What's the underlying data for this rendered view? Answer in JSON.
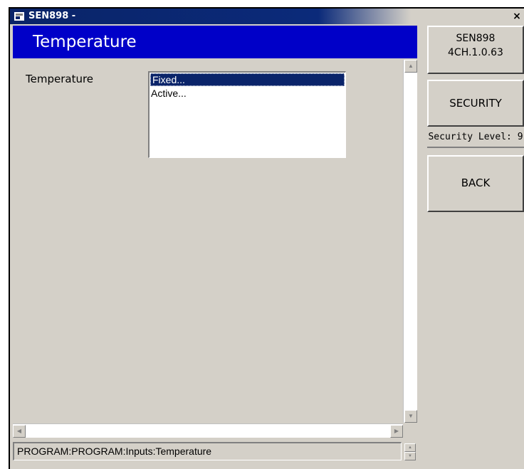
{
  "window": {
    "title": "SEN898 -",
    "close_glyph": "×"
  },
  "header": {
    "title": "Temperature"
  },
  "form": {
    "field_label": "Temperature",
    "options": [
      {
        "label": "Fixed...",
        "selected": true
      },
      {
        "label": "Active...",
        "selected": false
      }
    ]
  },
  "status_bar": {
    "path": "PROGRAM:PROGRAM:Inputs:Temperature"
  },
  "side_panel": {
    "device_name": "SEN898",
    "firmware": "4CH.1.0.63",
    "security_button": "SECURITY",
    "security_level": "Security Level: 9",
    "back_button": "BACK"
  },
  "colors": {
    "header_bg": "#0000c8",
    "titlebar_bg": "#0a2468",
    "selection_bg": "#0a246a",
    "window_bg": "#d4d0c8"
  },
  "icons": [
    "app-icon",
    "close-icon",
    "scroll-up-icon",
    "scroll-down-icon",
    "scroll-left-icon",
    "scroll-right-icon",
    "spin-up-icon",
    "spin-down-icon"
  ]
}
